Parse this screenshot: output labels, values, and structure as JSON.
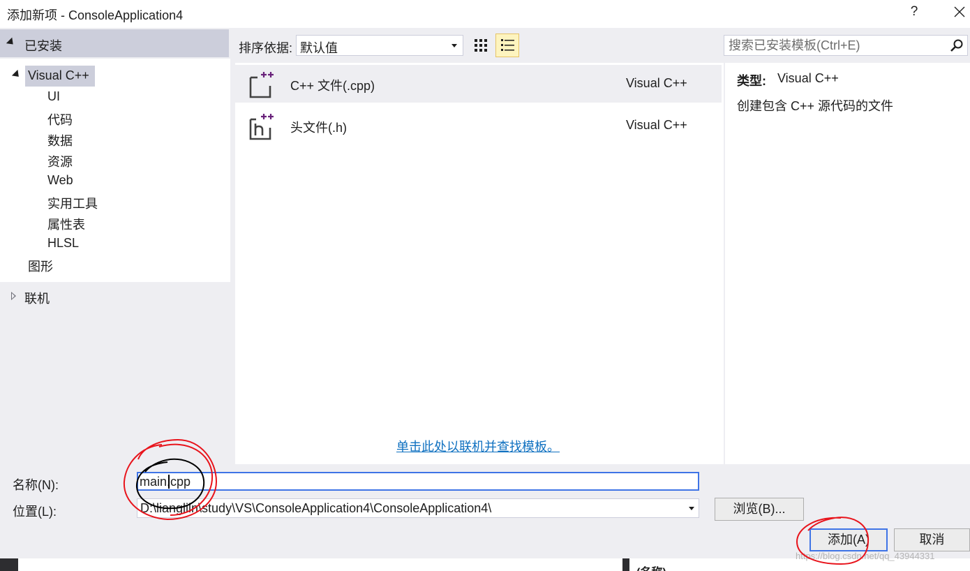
{
  "window": {
    "title": "添加新项 - ConsoleApplication4",
    "help_label": "?"
  },
  "tree": {
    "installed_label": "已安装",
    "visual_cpp_label": "Visual C++",
    "children": [
      "UI",
      "代码",
      "数据",
      "资源",
      "Web",
      "实用工具",
      "属性表",
      "HLSL"
    ],
    "graphics_label": "图形",
    "online_label": "联机"
  },
  "toolbar": {
    "sort_label": "排序依据:",
    "sort_value": "默认值",
    "search_placeholder": "搜索已安装模板(Ctrl+E)"
  },
  "templates": [
    {
      "name": "C++ 文件(.cpp)",
      "language": "Visual C++",
      "icon": "cpp-file-icon",
      "selected": true
    },
    {
      "name": "头文件(.h)",
      "language": "Visual C++",
      "icon": "header-file-icon",
      "selected": false
    }
  ],
  "online_link": "单击此处以联机并查找模板。",
  "details": {
    "type_label": "类型:",
    "type_value": "Visual C++",
    "description": "创建包含 C++ 源代码的文件"
  },
  "form": {
    "name_label": "名称(N):",
    "name_value": "main.cpp",
    "location_label": "位置(L):",
    "location_value": "D:\\liangliln\\study\\VS\\ConsoleApplication4\\ConsoleApplication4\\",
    "browse_label": "浏览(B)...",
    "add_label": "添加(A)",
    "cancel_label": "取消"
  },
  "background": {
    "partial_text": "(名称)",
    "watermark": "https://blog.csdn.net/qq_43944331"
  },
  "colors": {
    "panel_bg": "#eeeef2",
    "selection_bg": "#cccedb",
    "focus_border": "#3f74e6",
    "link": "#0e70c0",
    "accent_purple": "#68217a",
    "annotation_red": "#e8141c",
    "annotation_black": "#000000"
  }
}
